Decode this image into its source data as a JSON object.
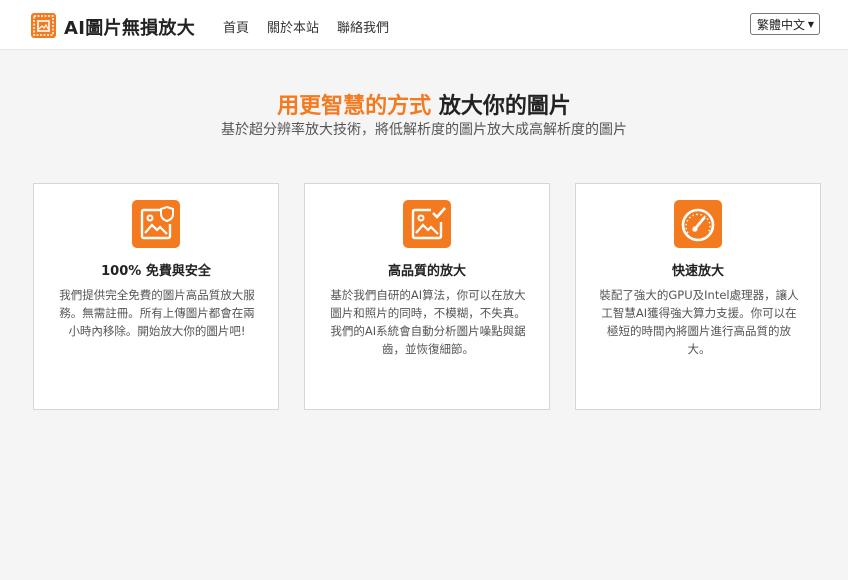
{
  "header": {
    "logo_text": "AI圖片無損放大",
    "logo_icon": "photo-frame-icon",
    "nav": [
      "首頁",
      "關於本站",
      "聯絡我們"
    ],
    "language": "繁體中文"
  },
  "hero": {
    "title_accent": "用更智慧的方式",
    "title_rest": "放大你的圖片",
    "subtitle": "基於超分辨率放大技術，將低解析度的圖片放大成高解析度的圖片"
  },
  "features": [
    {
      "icon": "image-shield-icon",
      "title": "100% 免費與安全",
      "desc": "我們提供完全免費的圖片高品質放大服務。無需註冊。所有上傳圖片都會在兩小時內移除。開始放大你的圖片吧!"
    },
    {
      "icon": "image-check-icon",
      "title": "高品質的放大",
      "desc": "基於我們自研的AI算法，你可以在放大圖片和照片的同時，不模糊，不失真。我們的AI系統會自動分析圖片噪點與鋸齒，並恢復細節。"
    },
    {
      "icon": "speedometer-icon",
      "title": "快速放大",
      "desc": "裝配了強大的GPU及Intel處理器，讓人工智慧AI獲得強大算力支援。你可以在極短的時間內將圖片進行高品質的放大。"
    }
  ],
  "colors": {
    "accent": "#f47a20",
    "background": "#f5f5f5",
    "card": "#ffffff"
  }
}
